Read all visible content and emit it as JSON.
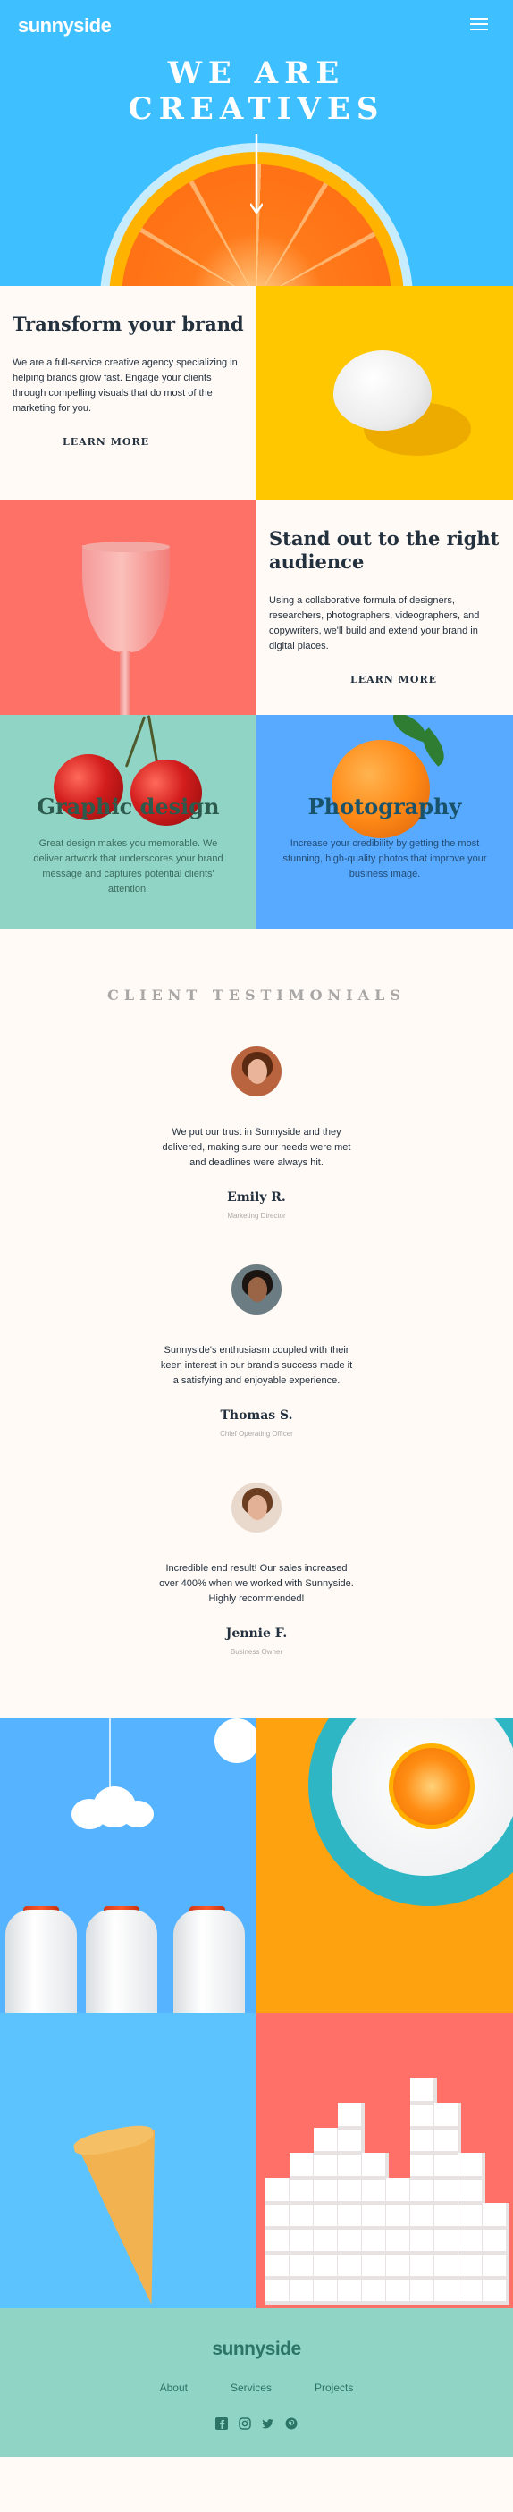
{
  "header": {
    "logo": "sunnyside",
    "hero_title_line1": "WE ARE",
    "hero_title_line2": "CREATIVES",
    "menu_icon": "hamburger-menu-icon",
    "scroll_icon": "arrow-down-icon"
  },
  "transform": {
    "title": "Transform your brand",
    "body": "We are a full-service creative agency specializing in helping brands grow fast. Engage your clients through compelling visuals that do most of the marketing for you.",
    "link": "LEARN MORE"
  },
  "standout": {
    "title": "Stand out to the right audience",
    "body": "Using a collaborative formula of designers, researchers, photographers, videographers, and copywriters, we'll build and extend your brand in digital places.",
    "link": "LEARN MORE"
  },
  "services": [
    {
      "title": "Graphic design",
      "body": "Great design makes you memorable. We deliver artwork that underscores your brand message and captures potential clients' attention."
    },
    {
      "title": "Photography",
      "body": "Increase your credibility by getting the most stunning, high-quality photos that improve your business image."
    }
  ],
  "testimonials": {
    "heading": "CLIENT TESTIMONIALS",
    "items": [
      {
        "quote": "We put our trust in Sunnyside and they delivered, making sure our needs were met and deadlines were always hit.",
        "name": "Emily R.",
        "role": "Marketing Director"
      },
      {
        "quote": "Sunnyside's enthusiasm coupled with their keen interest in our brand's success made it a satisfying and enjoyable experience.",
        "name": "Thomas S.",
        "role": "Chief Operating Officer"
      },
      {
        "quote": "Incredible end result! Our sales increased over 400% when we worked with Sunnyside. Highly recommended!",
        "name": "Jennie F.",
        "role": "Business Owner"
      }
    ]
  },
  "footer": {
    "logo": "sunnyside",
    "nav": [
      "About",
      "Services",
      "Projects"
    ],
    "social": [
      "facebook-icon",
      "instagram-icon",
      "twitter-icon",
      "pinterest-icon"
    ]
  },
  "colors": {
    "hero_blue": "#3ebfff",
    "yellow": "#ffc700",
    "coral": "#fe7167",
    "mint": "#90d4c5",
    "dark_text": "#23303e"
  }
}
